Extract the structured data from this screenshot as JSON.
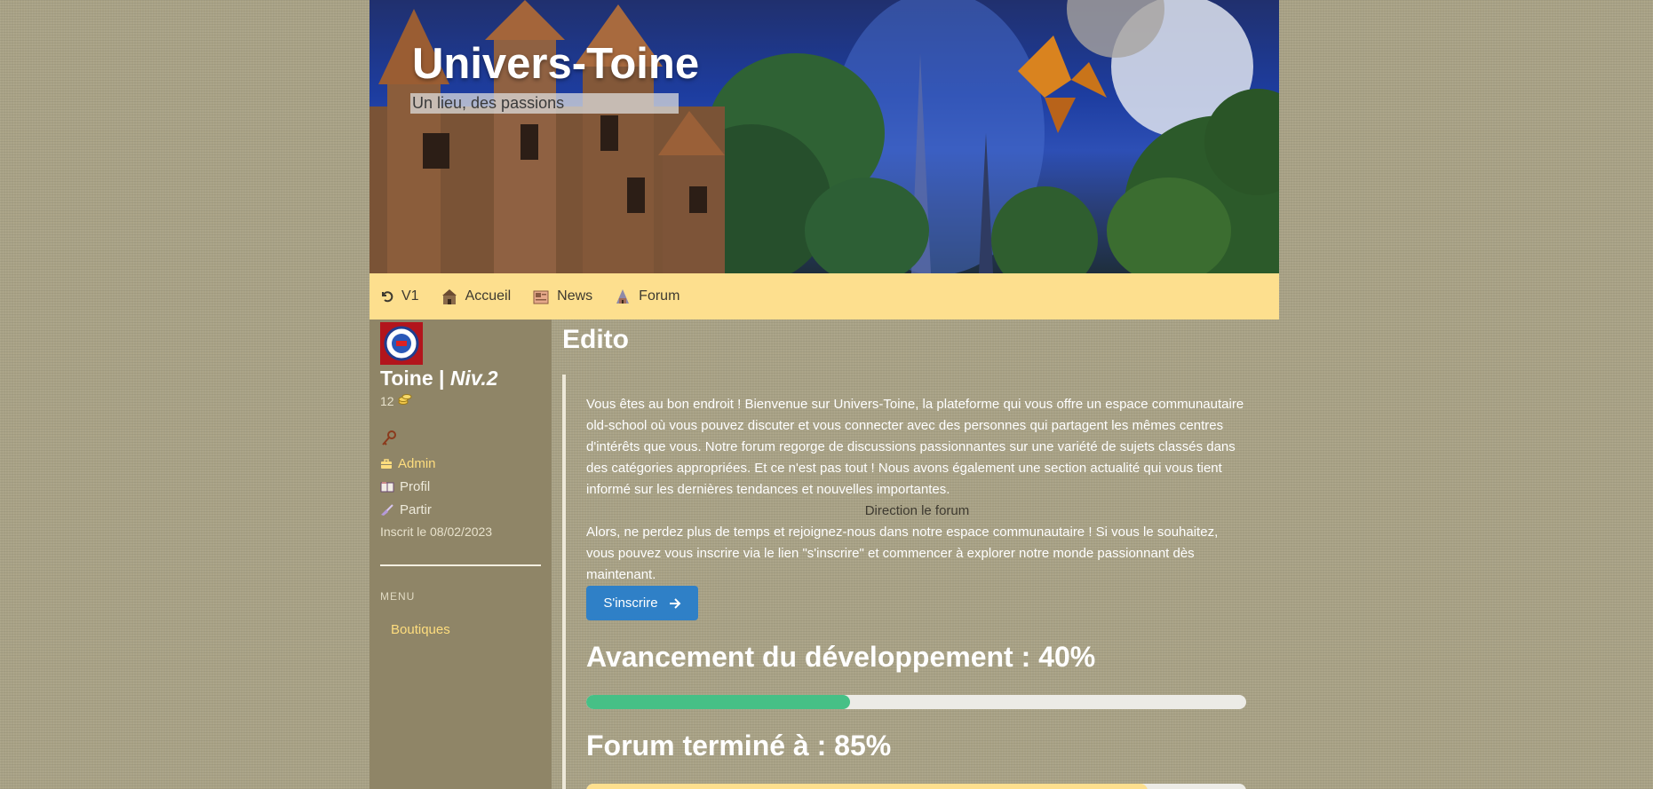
{
  "header": {
    "site_title": "Univers-Toine",
    "tagline": "Un lieu, des passions"
  },
  "nav": {
    "items": [
      {
        "label": "V1",
        "icon": "undo-icon"
      },
      {
        "label": "Accueil",
        "icon": "castle-icon"
      },
      {
        "label": "News",
        "icon": "newspaper-icon"
      },
      {
        "label": "Forum",
        "icon": "forum-castle-icon"
      }
    ]
  },
  "sidebar": {
    "username": "Toine",
    "separator": " | ",
    "level": "Niv.2",
    "coins": "12",
    "links": [
      {
        "label": "Admin",
        "icon": "toolbox-icon"
      },
      {
        "label": "Profil",
        "icon": "book-icon"
      },
      {
        "label": "Partir",
        "icon": "broom-icon"
      }
    ],
    "registered": "Inscrit le 08/02/2023",
    "menu_label": "MENU",
    "menu_items": [
      {
        "label": "Boutiques"
      }
    ]
  },
  "main": {
    "edito_title": "Edito",
    "paragraph1": "Vous êtes au bon endroit ! Bienvenue sur Univers-Toine, la plateforme qui vous offre un espace communautaire old-school où vous pouvez discuter et vous connecter avec des personnes qui partagent les mêmes centres d'intérêts que vous. Notre forum regorge de discussions passionnantes sur une variété de sujets classés dans des catégories appropriées. Et ce n'est pas tout ! Nous avons également une section actualité qui vous tient informé sur les dernières tendances et nouvelles importantes.",
    "direction_label": "Direction le forum",
    "paragraph2": "Alors, ne perdez plus de temps et rejoignez-nous dans notre espace communautaire ! Si vous le souhaitez, vous pouvez vous inscrire via le lien \"s'inscrire\" et commencer à explorer notre monde passionnant dès maintenant.",
    "signup_button": "S'inscrire",
    "progress": [
      {
        "title": "Avancement du développement : 40%",
        "value": 0.4,
        "color": "#46c086"
      },
      {
        "title": "Forum terminé à : 85%",
        "value": 0.85,
        "color": "#fddf8e"
      }
    ]
  },
  "colors": {
    "nav_bg": "#fddf8e",
    "sidebar_bg": "#8f8567",
    "accent_link": "#fedd7e",
    "button_blue": "#2f80c7"
  }
}
